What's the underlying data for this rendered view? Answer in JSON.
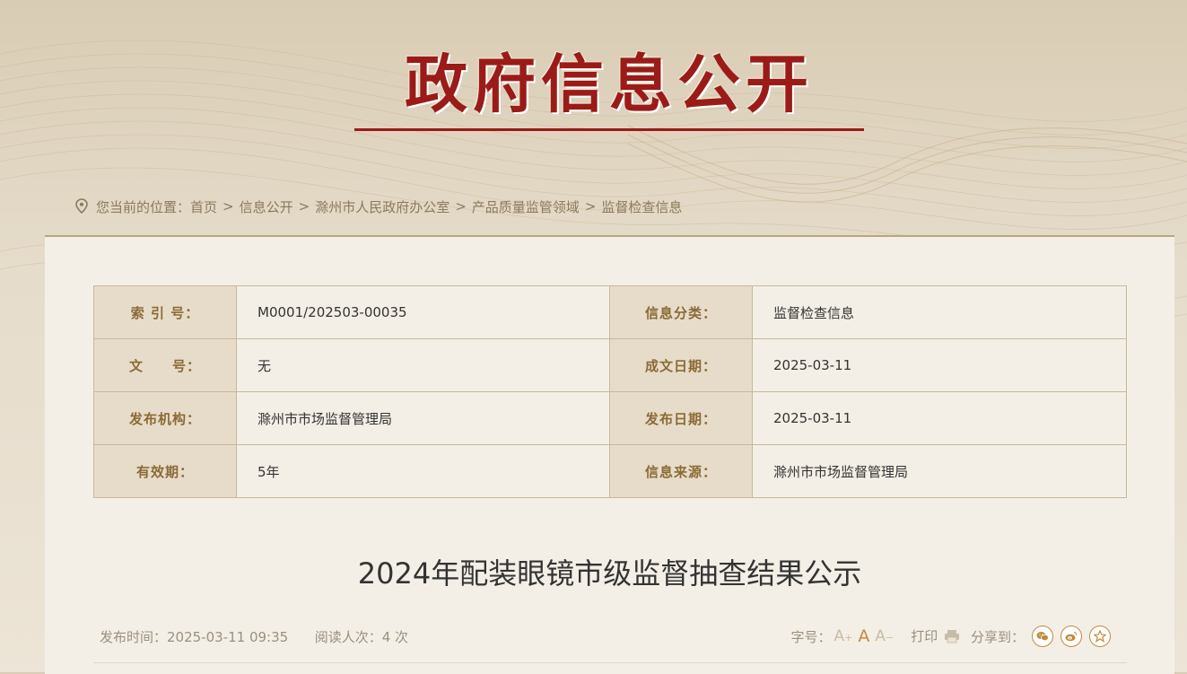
{
  "banner": {
    "title": "政府信息公开"
  },
  "breadcrumb": {
    "prefix": "您当前的位置：",
    "items": [
      "首页",
      "信息公开",
      "滁州市人民政府办公室",
      "产品质量监管领域",
      "监督检查信息"
    ],
    "separator": ">"
  },
  "meta": {
    "rows": [
      {
        "label_left": "索 引 号：",
        "value_left": "M0001/202503-00035",
        "label_right": "信息分类：",
        "value_right": "监督检查信息"
      },
      {
        "label_left": "文　　号：",
        "value_left": "无",
        "label_right": "成文日期：",
        "value_right": "2025-03-11"
      },
      {
        "label_left": "发布机构：",
        "value_left": "滁州市市场监督管理局",
        "label_right": "发布日期：",
        "value_right": "2025-03-11"
      },
      {
        "label_left": "有效期：",
        "value_left": "5年",
        "label_right": "信息来源：",
        "value_right": "滁州市市场监督管理局"
      }
    ]
  },
  "article": {
    "title": "2024年配装眼镜市级监督抽查结果公示",
    "publish_time": "发布时间：2025-03-11 09:35",
    "read_count": "阅读人次：4 次",
    "font_size_label": "字号：",
    "font_sizes": [
      "A",
      "A",
      "A"
    ],
    "font_size_marks": [
      "+",
      "",
      "−"
    ],
    "print_label": "打印",
    "share_label": "分享到："
  },
  "icons": {
    "location": "location-pin-icon",
    "print": "printer-icon",
    "share": [
      "wechat-icon",
      "weibo-icon",
      "favorite-star-icon"
    ]
  },
  "colors": {
    "title_red": "#9a1b17",
    "label_brown": "#8a6a37",
    "accent_gold": "#c28a3a",
    "label_bg": "#e7dcc9",
    "content_bg": "#f4efe6"
  }
}
